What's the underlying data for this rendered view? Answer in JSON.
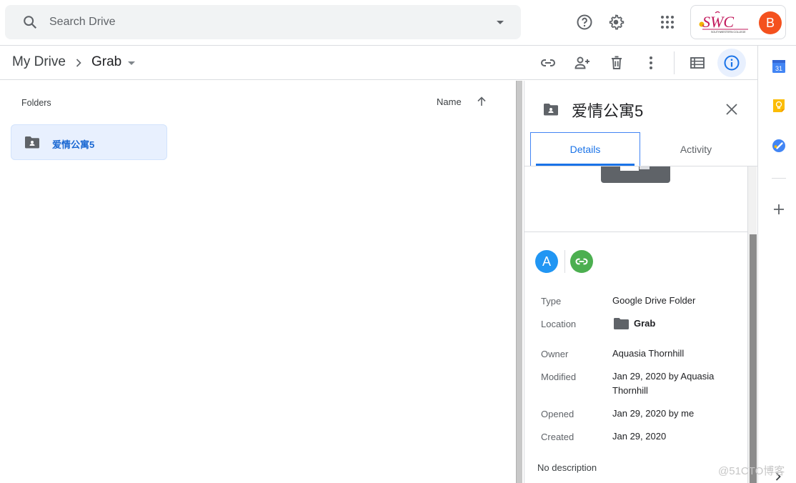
{
  "search": {
    "placeholder": "Search Drive",
    "icon": "search-icon",
    "options_icon": "caret-down-icon"
  },
  "header_actions": {
    "support_icon": "help-circle-icon",
    "settings_icon": "gear-icon",
    "apps_icon": "apps-grid-icon",
    "org_logo_text": "SWC",
    "org_logo_subtext": "SOUTHWESTERN COLLEGE",
    "avatar_initial": "B",
    "avatar_color": "#f4511e"
  },
  "breadcrumb": {
    "items": [
      {
        "label": "My Drive"
      },
      {
        "label": "Grab"
      }
    ]
  },
  "toolbar": {
    "actions": [
      "link-icon",
      "share-person-add-icon",
      "trash-icon",
      "more-vert-icon",
      "list-view-icon",
      "info-icon"
    ]
  },
  "main": {
    "section_label": "Folders",
    "sort_label": "Name",
    "sort_direction": "ascending",
    "folders": [
      {
        "name": "爱情公寓5",
        "icon": "shared-folder-icon",
        "selected": true
      }
    ]
  },
  "details_panel": {
    "title": "爱情公寓5",
    "tabs": [
      {
        "label": "Details",
        "active": true
      },
      {
        "label": "Activity",
        "active": false
      }
    ],
    "access": {
      "avatar_initial": "A",
      "avatar_color": "#2196f3",
      "link_color": "#4caf50"
    },
    "properties": [
      {
        "label": "Type",
        "value": "Google Drive Folder"
      },
      {
        "label": "Location",
        "value": "Grab"
      },
      {
        "label": "Owner",
        "value": "Aquasia Thornhill"
      },
      {
        "label": "Modified",
        "value": "Jan 29, 2020 by Aquasia Thornhill"
      },
      {
        "label": "Opened",
        "value": "Jan 29, 2020 by me"
      },
      {
        "label": "Created",
        "value": "Jan 29, 2020"
      }
    ],
    "description": "No description"
  },
  "side_panel": {
    "apps": [
      "calendar-icon",
      "keep-icon",
      "tasks-icon"
    ],
    "calendar_day": "31",
    "add_label": "+"
  },
  "watermark": "@51CTO博客",
  "colors": {
    "accent": "#1a73e8",
    "selected_bg": "#e8f0fe",
    "icon_gray": "#5f6368"
  }
}
